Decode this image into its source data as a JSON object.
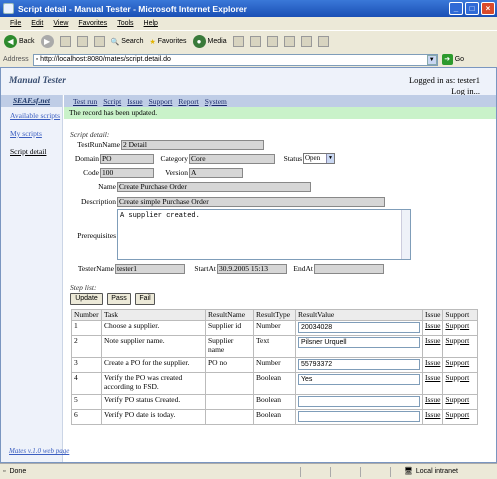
{
  "window": {
    "title": "Script detail - Manual Tester - Microsoft Internet Explorer"
  },
  "menu": [
    "File",
    "Edit",
    "View",
    "Favorites",
    "Tools",
    "Help"
  ],
  "toolbar": {
    "back": "Back",
    "search": "Search",
    "favorites": "Favorites",
    "media": "Media"
  },
  "address": {
    "label": "Address",
    "url": "http://localhost:8080/mates/script.detail.do",
    "go": "Go"
  },
  "header": {
    "app_title": "Manual Tester",
    "logged_in": "Logged in as: tester1",
    "logout": "Log in..."
  },
  "sidebar": {
    "brand": "SEAF.sf.net",
    "items": [
      "Available scripts",
      "My scripts",
      "Script detail"
    ]
  },
  "tabs": [
    "Test run",
    "Script",
    "Issue",
    "Support",
    "Report",
    "System"
  ],
  "message": "The record has been updated.",
  "script": {
    "section_title": "Script detail:",
    "test_run_label": "TestRunName",
    "test_run": "2 Detail",
    "domain_label": "Domain",
    "domain": "PO",
    "category_label": "Category",
    "category": "Core",
    "status_label": "Status",
    "status": "Open",
    "code_label": "Code",
    "code": "100",
    "version_label": "Version",
    "version": "A",
    "name_label": "Name",
    "name": "Create Purchase Order",
    "description_label": "Description",
    "description": "Create simple Purchase Order",
    "prerequisites_label": "Prerequisites",
    "prerequisites": "A supplier created.",
    "tester_label": "TesterName",
    "tester": "tester1",
    "start_label": "StartAt",
    "start": "30.9.2005 15:13",
    "end_label": "EndAt",
    "end": ""
  },
  "steps": {
    "section_title": "Step list:",
    "buttons": [
      "Update",
      "Pass",
      "Fail"
    ],
    "columns": [
      "Number",
      "Task",
      "ResultName",
      "ResultType",
      "ResultValue",
      "Issue",
      "Support"
    ],
    "rows": [
      {
        "number": "1",
        "task": "Choose a supplier.",
        "result_name": "Supplier id",
        "result_type": "Number",
        "result_value": "20034028",
        "issue": "Issue",
        "support": "Support"
      },
      {
        "number": "2",
        "task": "Note supplier name.",
        "result_name": "Supplier name",
        "result_type": "Text",
        "result_value": "Pilsner Urquell",
        "issue": "Issue",
        "support": "Support"
      },
      {
        "number": "3",
        "task": "Create a PO for the supplier.",
        "result_name": "PO no",
        "result_type": "Number",
        "result_value": "55793372",
        "issue": "Issue",
        "support": "Support"
      },
      {
        "number": "4",
        "task": "Verify the PO was created according to FSD.",
        "result_name": "",
        "result_type": "Boolean",
        "result_value": "Yes",
        "issue": "Issue",
        "support": "Support"
      },
      {
        "number": "5",
        "task": "Verify PO status Created.",
        "result_name": "",
        "result_type": "Boolean",
        "result_value": "",
        "issue": "Issue",
        "support": "Support"
      }
    ],
    "row6": {
      "number": "6",
      "task": "Verify PO date is today.",
      "result_name": "",
      "result_type": "Boolean",
      "result_value": "",
      "issue": "Issue",
      "support": "Support"
    }
  },
  "footer": {
    "link": "Mates v.1.0 web page"
  },
  "status": {
    "text": "Done",
    "zone": "Local intranet"
  }
}
